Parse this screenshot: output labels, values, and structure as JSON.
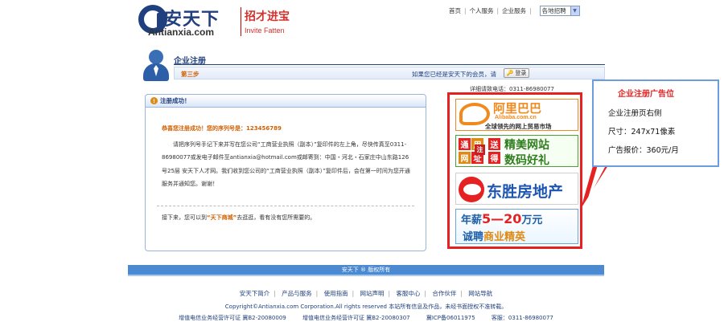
{
  "logo": {
    "brand_cn": "安天下",
    "brand_en": "Antianxia.com",
    "slogan": "招才进宝",
    "slogan_en": "Invite Fatten"
  },
  "topnav": {
    "items": [
      "首页",
      "个人服务",
      "企业服务"
    ],
    "region_select": "各地招聘"
  },
  "page": {
    "heading": "企业注册",
    "step": "第三步",
    "member_hint": "如果您已经是安天下的会员，请",
    "login_label": "登录",
    "hotline": "详细请致电话：0311-86980077"
  },
  "success": {
    "title": "注册成功！",
    "congrats": "恭喜您注册成功！您的序列号是：123456789",
    "instruction": "请把序列号手记下来并写在您公司“工商营业执照（副本）”复印件的左上角，尽快传真至0311-86980077或发电子邮件至antianxia@hotmail.com或邮寄到：中国・河北・石家庄中山东路126号25层 安天下人才网。我们收到您公司的“工商营业执照（副本）”复印件后，会在第一时间为您开通服务并通知您。谢谢！",
    "next_prefix": "接下来，您可以到",
    "next_link": "“天下商城”",
    "next_suffix": "去逛逛，看有没有您所需要的。"
  },
  "ads": {
    "alibaba_name": "阿里巴巴",
    "alibaba_domain": "Alibaba.com.cn",
    "alibaba_tagline": "全球领先的网上贸易市场",
    "tyzs_chars": [
      "通",
      "用",
      "网",
      "址",
      "注",
      "册",
      "送",
      "得"
    ],
    "tyzs_line1": "精美网站",
    "tyzs_line2": "数码好礼",
    "dongsheng": "东胜房地产",
    "salary_prefix": "年薪",
    "salary_range": "5—20",
    "salary_suffix": "万元",
    "salary_line2_a": "诚聘",
    "salary_line2_b": "商业精英"
  },
  "callout": {
    "title": "企业注册广告位",
    "lines": [
      "企业注册页右侧",
      "尺寸：247x71像素",
      "广告报价：360元/月"
    ]
  },
  "footer": {
    "bar": "安天下 ® 版权所有",
    "links": [
      "安天下简介",
      "产品与服务",
      "使用指南",
      "网站声明",
      "客服中心",
      "合作伙伴",
      "网站导航"
    ],
    "copyright": "Copyright©Antianxia.com Corporation.All rights reserved 本站所有信息及作品，未经书面授权不准转载。",
    "license_a": "增值电信业务经营许可证 冀B2-20080009",
    "license_b": "增值电信业务经营许可证 冀B2-20080307",
    "license_c": "冀ICP备06011975",
    "license_d": "客服：0311-86980077"
  },
  "colors": {
    "brand_blue": "#1f3f7e",
    "accent_orange": "#d25f00",
    "ad_border_red": "#e52121",
    "footer_blue": "#4b8ad0"
  }
}
